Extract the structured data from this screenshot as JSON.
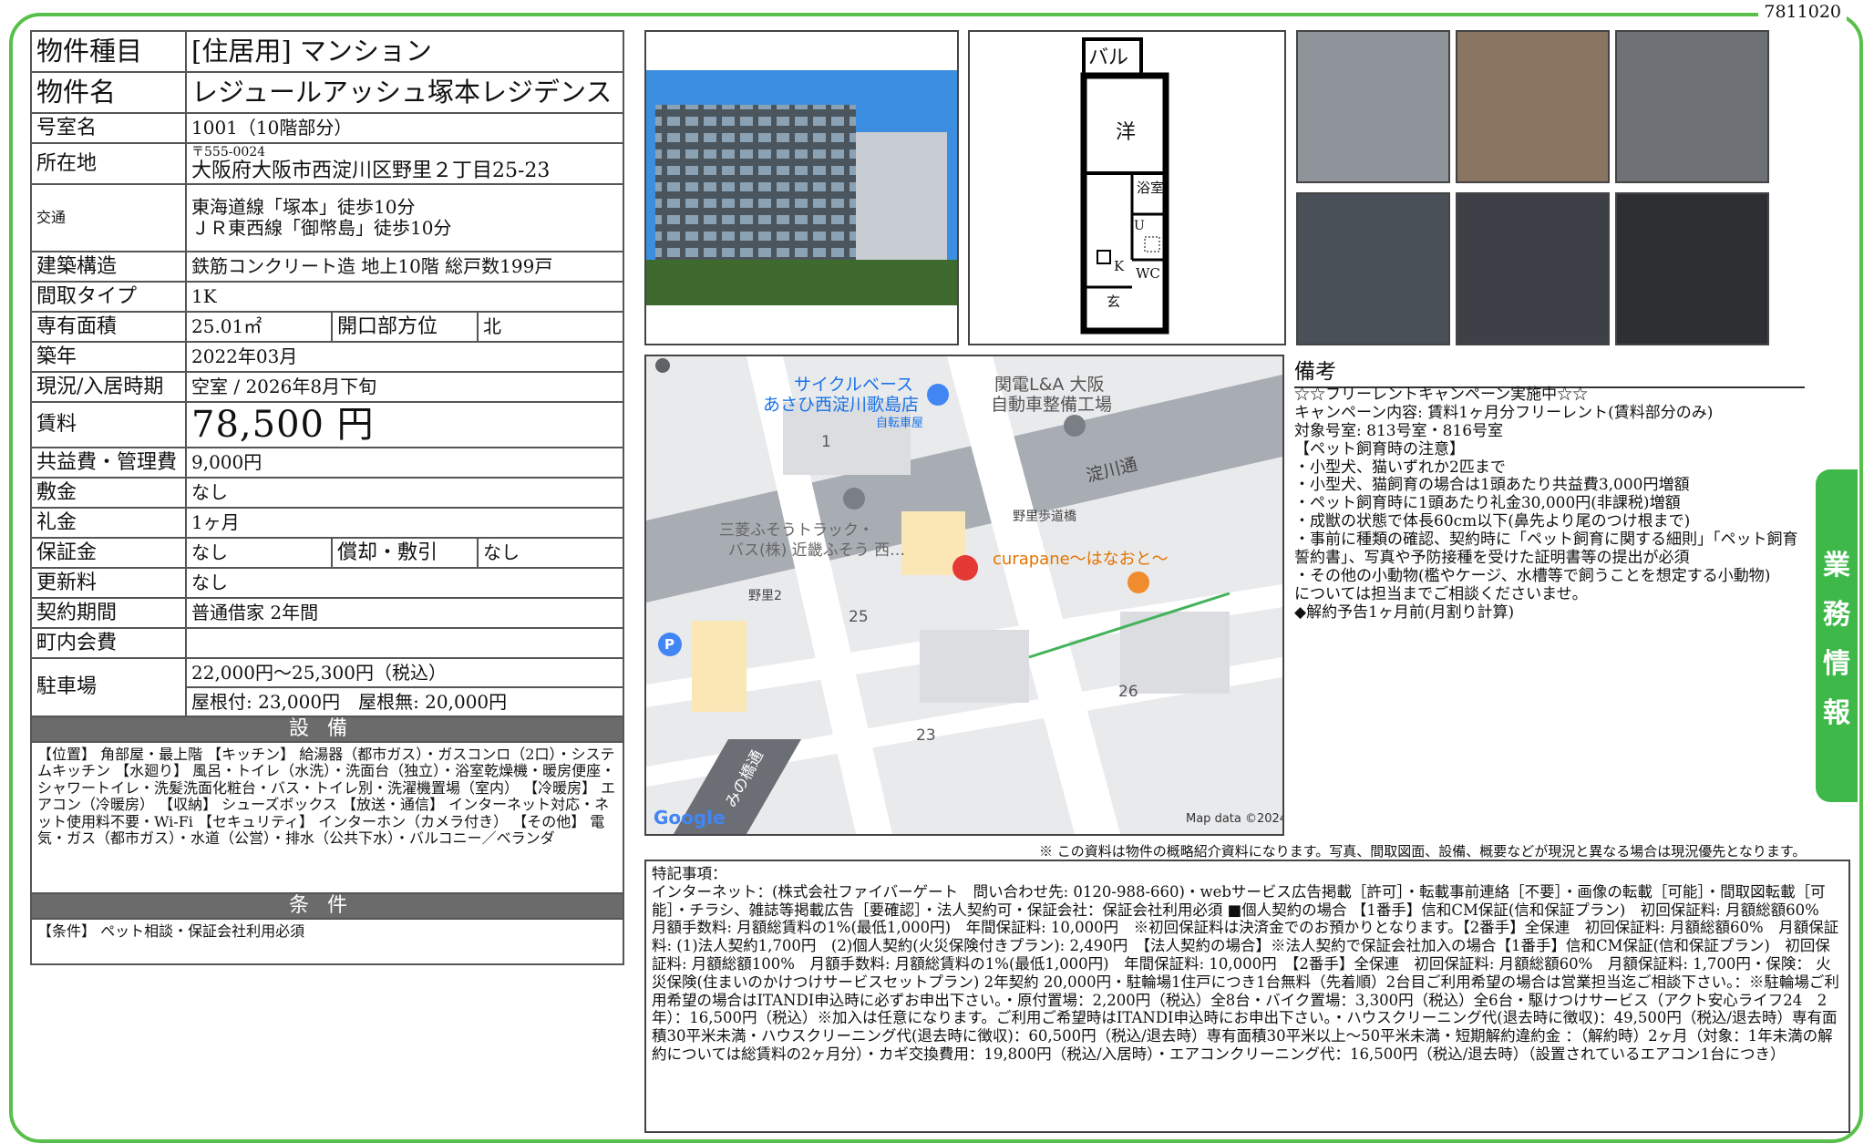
{
  "doc_id": "7811020",
  "spec": {
    "type_label": "物件種目",
    "type_value": "[住居用] マンション",
    "name_label": "物件名",
    "name_value": "レジュールアッシュ塚本レジデンス",
    "room_label": "号室名",
    "room_value": "1001（10階部分）",
    "address_label": "所在地",
    "postal": "〒555-0024",
    "address": "大阪府大阪市西淀川区野里２丁目25-23",
    "transport_label": "交通",
    "transport_1": "東海道線「塚本」徒歩10分",
    "transport_2": "ＪＲ東西線「御幣島」徒歩10分",
    "structure_label": "建築構造",
    "structure_value": "鉄筋コンクリート造 地上10階 総戸数199戸",
    "layout_label": "間取タイプ",
    "layout_value": "1K",
    "area_label": "専有面積",
    "area_value": "25.01㎡",
    "direction_label": "開口部方位",
    "direction_value": "北",
    "built_label": "築年",
    "built_value": "2022年03月",
    "status_label": "現況/入居時期",
    "status_value": "空室 / 2026年8月下旬",
    "rent_label": "賃料",
    "rent_value": "78,500 円",
    "fee_label": "共益費・管理費",
    "fee_value": "9,000円",
    "deposit_label": "敷金",
    "deposit_value": "なし",
    "key_money_label": "礼金",
    "key_money_value": "1ヶ月",
    "guarantee_label": "保証金",
    "guarantee_value": "なし",
    "amort_label": "償却・敷引",
    "amort_value": "なし",
    "renewal_label": "更新料",
    "renewal_value": "なし",
    "contract_label": "契約期間",
    "contract_value": "普通借家 2年間",
    "community_label": "町内会費",
    "community_value": "",
    "parking_label": "駐車場",
    "parking_1": "22,000円～25,300円（税込）",
    "parking_2": "屋根付: 23,000円　屋根無: 20,000円",
    "equip_header": "設備",
    "equip_text": "【位置】 角部屋・最上階 【キッチン】 給湯器（都市ガス）・ガスコンロ（2口）・システムキッチン 【水廻り】 風呂・トイレ（水洗）・洗面台（独立）・浴室乾燥機・暖房便座・シャワートイレ・洗髪洗面化粧台・バス・トイレ別・洗濯機置場（室内） 【冷暖房】 エアコン（冷暖房） 【収納】 シューズボックス 【放送・通信】 インターネット対応・ネット使用料不要・Wi-Fi 【セキュリティ】 インターホン（カメラ付き） 【その他】 電気・ガス（都市ガス）・水道（公営）・排水（公共下水）・バルコニー／ベランダ",
    "cond_header": "条件",
    "cond_text": "【条件】 ペット相談・保証会社利用必須"
  },
  "floorplan": {
    "balcony": "バル",
    "western": "洋",
    "bath": "浴室",
    "wc": "WC",
    "kitchen": "K",
    "entrance": "玄",
    "wash": "U"
  },
  "map": {
    "store1": "サイクルベース",
    "store2": "あさひ西淀川歌島店",
    "store3": "自転車屋",
    "garage1": "関電L&A 大阪",
    "garage2": "自動車整備工場",
    "road": "淀川通",
    "crossing": "野里歩道橋",
    "crossing2": "野里2",
    "truck1": "三菱ふそうトラック・",
    "truck2": "バス(株) 近畿ふそう 西…",
    "cafe": "curapane～はなおと～",
    "block1": "1",
    "block25": "25",
    "block26": "26",
    "block23": "23",
    "bridge": "みの橋通",
    "logo": "Google",
    "credit": "Map data ©2024",
    "parking_icon": "P"
  },
  "notes": {
    "title": "備考",
    "lines": [
      "☆☆フリーレントキャンペーン実施中☆☆",
      "キャンペーン内容: 賃料1ヶ月分フリーレント(賃料部分のみ)",
      "対象号室: 813号室・816号室",
      "【ペット飼育時の注意】",
      "・小型犬、猫いずれか2匹まで",
      "・小型犬、猫飼育の場合は1頭あたり共益費3,000円増額",
      "・ペット飼育時に1頭あたり礼金30,000円(非課税)増額",
      "・成獣の状態で体長60cm以下(鼻先より尾のつけ根まで)",
      "・事前に種類の確認、契約時に「ペット飼育に関する細則」「ペット飼育",
      "誓約書」、写真や予防接種を受けた証明書等の提出が必須",
      "・その他の小動物(檻やケージ、水槽等で飼うことを想定する小動物)",
      "については担当までご相談くださいませ。",
      "◆解約予告1ヶ月前(月割り計算)"
    ]
  },
  "disclaimer": "※ この資料は物件の概略紹介資料になります。写真、間取図面、設備、概要などが現況と異なる場合は現況優先となります。",
  "special": {
    "title": "特記事項：",
    "body": "インターネット：(株式会社ファイバーゲート　問い合わせ先: 0120-988-660)・webサービス広告掲載［許可］・転載事前連絡［不要］・画像の転載［可能］・間取図転載［可能］・チラシ、雑誌等掲載広告［要確認］・法人契約可・保証会社：保証会社利用必須 ■個人契約の場合 【1番手】信和CM保証(信和保証プラン)　初回保証料: 月額総額60%　月額手数料: 月額総賃料の1%(最低1,000円)　年間保証料: 10,000円　※初回保証料は決済金でのお預かりとなります。【2番手】全保連　初回保証料: 月額総額60%　月額保証料: (1)法人契約1,700円　(2)個人契約(火災保険付きプラン): 2,490円　【法人契約の場合】※法人契約で保証会社加入の場合【1番手】信和CM保証(信和保証プラン)　初回保証料: 月額総額100%　月額手数料: 月額総賃料の1%(最低1,000円)　年間保証料: 10,000円　【2番手】全保連　初回保証料: 月額総額60%　月額保証料: 1,700円・保険： 火災保険(住まいのかけつけサービスセットプラン) 2年契約 20,000円・駐輪場1住戸につき1台無料（先着順）2台目ご利用希望の場合は営業担当迄ご相談下さい。：※駐輪場ご利用希望の場合はITANDI申込時に必ずお申出下さい。・原付置場：2,200円（税込）全8台・バイク置場：3,300円（税込）全6台・駆けつけサービス（アクト安心ライフ24　2年）：16,500円（税込）※加入は任意になります。ご利用ご希望時はITANDI申込時にお申出下さい。・ハウスクリーニング代(退去時に徴収)：49,500円（税込/退去時）専有面積30平米未満・ハウスクリーニング代(退去時に徴収)：60,500円（税込/退去時）専有面積30平米以上～50平米未満・短期解約違約金 ：（解約時）2ヶ月（対象：1年未満の解約については総賃料の2ヶ月分）・カギ交換費用：19,800円（税込/入居時）・エアコンクリーニング代：16,500円（税込/退去時）（設置されているエアコン1台につき）"
  },
  "side_tab": [
    "業",
    "務",
    "情",
    "報"
  ],
  "colors": {
    "frame": "#57c04a",
    "tab": "#3fb84a",
    "section_header": "#6b6b6b"
  }
}
